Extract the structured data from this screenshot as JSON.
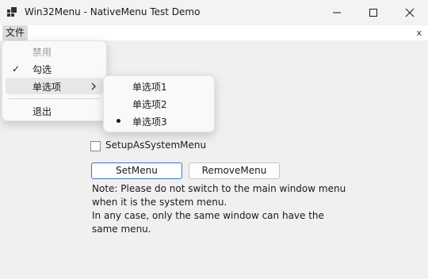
{
  "window": {
    "title": "Win32Menu - NativeMenu Test Demo",
    "icon": "app-window-icon",
    "controls": {
      "minimize": "minimize-icon",
      "maximize": "maximize-icon",
      "close": "close-icon"
    }
  },
  "menubar": {
    "file_label": "文件",
    "mdi_close": "x"
  },
  "file_menu": {
    "items": [
      {
        "label": "禁用",
        "state": "disabled"
      },
      {
        "label": "勾选",
        "state": "checked"
      },
      {
        "label": "单选项",
        "state": "submenu-open"
      },
      {
        "label": "退出",
        "state": "normal"
      }
    ]
  },
  "radio_submenu": {
    "items": [
      {
        "label": "单选项1"
      },
      {
        "label": "单选项2"
      },
      {
        "label": "单选项3",
        "selected": true
      }
    ]
  },
  "form": {
    "checkbox_label": "SetupAsSystemMenu",
    "checkbox_checked": false,
    "set_menu_label": "SetMenu",
    "remove_menu_label": "RemoveMenu",
    "note_lines": [
      "Note: Please do not switch to the main window menu",
      "when it is the system menu.",
      "In any case, only the same window can have the",
      "same menu."
    ]
  },
  "colors": {
    "accent_border": "#3c75c5",
    "window_bg": "#f0f0f0",
    "menu_bg": "#f9f9f9"
  }
}
